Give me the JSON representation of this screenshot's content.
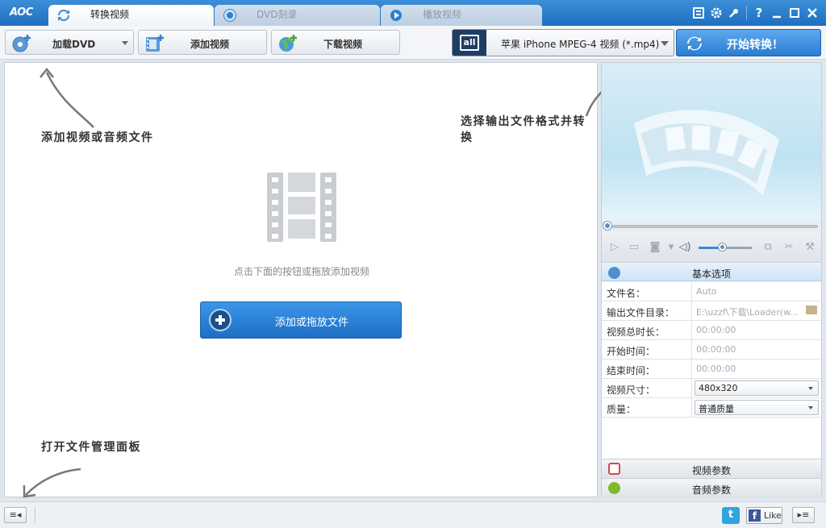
{
  "app": {
    "logo": "AOC"
  },
  "tabs": [
    {
      "label": "转换视频",
      "active": true
    },
    {
      "label": "DVD刻录",
      "active": false
    },
    {
      "label": "播放视频",
      "active": false
    }
  ],
  "window_controls": {
    "help": "?"
  },
  "toolbar": {
    "load_dvd": "加载DVD",
    "add_video": "添加视频",
    "download_video": "下载视频",
    "format_badge": "all",
    "format_value": "苹果 iPhone MPEG-4 视频 (*.mp4)",
    "convert": "开始转换！"
  },
  "main": {
    "hint_add": "添加视频或音频文件",
    "hint_format": "选择输出文件格式并转换",
    "hint_open": "打开文件管理面板",
    "center_message": "点击下面的按钮或拖放添加视频",
    "drop_button": "添加或拖放文件"
  },
  "options": {
    "title": "基本选项",
    "rows": [
      {
        "key": "文件名：",
        "value": "Auto"
      },
      {
        "key": "输出文件目录：",
        "value": "E:\\uzzf\\下载\\Loader(w..."
      },
      {
        "key": "视频总时长：",
        "value": "00:00:00"
      },
      {
        "key": "开始时间：",
        "value": "00:00:00"
      },
      {
        "key": "结束时间：",
        "value": "00:00:00"
      },
      {
        "key": "视频尺寸：",
        "value": "480x320"
      },
      {
        "key": "质量：",
        "value": "普通质量"
      }
    ],
    "video_params": "视频参数",
    "audio_params": "音频参数"
  },
  "player": {
    "volume": 0.45,
    "position": 0
  },
  "social": {
    "twitter": "t",
    "like": "Like",
    "fb": "f"
  },
  "colors": {
    "accent": "#2a7dd2",
    "titlebar": "#1e6fc0"
  }
}
